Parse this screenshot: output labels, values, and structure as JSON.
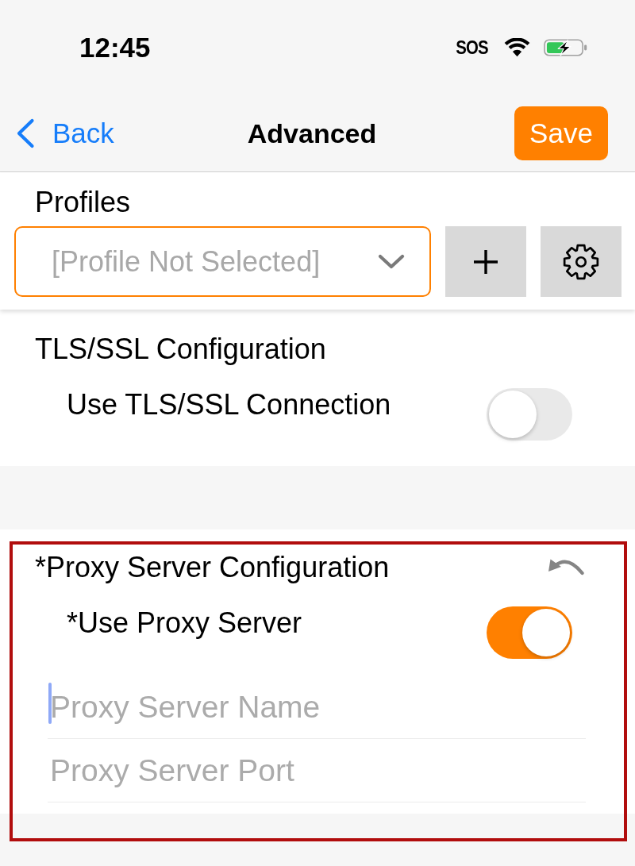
{
  "status_bar": {
    "time": "12:45",
    "status_text": "SOS"
  },
  "nav_bar": {
    "back": "Back",
    "title": "Advanced",
    "action": "Save"
  },
  "profiles": {
    "label": "Profiles",
    "dropdown": {
      "placeholder": "[Profile Not Selected]"
    }
  },
  "tls_section": {
    "title": "TLS/SSL Configuration",
    "setting": {
      "label": "Use TLS/SSL Connection",
      "on": false
    }
  },
  "proxy_section": {
    "title": "*Proxy Server Configuration",
    "highlighted": true,
    "setting": {
      "label": "*Use Proxy Server",
      "on": true
    },
    "fields": [
      {
        "placeholder": "Proxy Server Name",
        "focused": true
      },
      {
        "placeholder": "Proxy Server Port",
        "focused": false
      }
    ]
  }
}
